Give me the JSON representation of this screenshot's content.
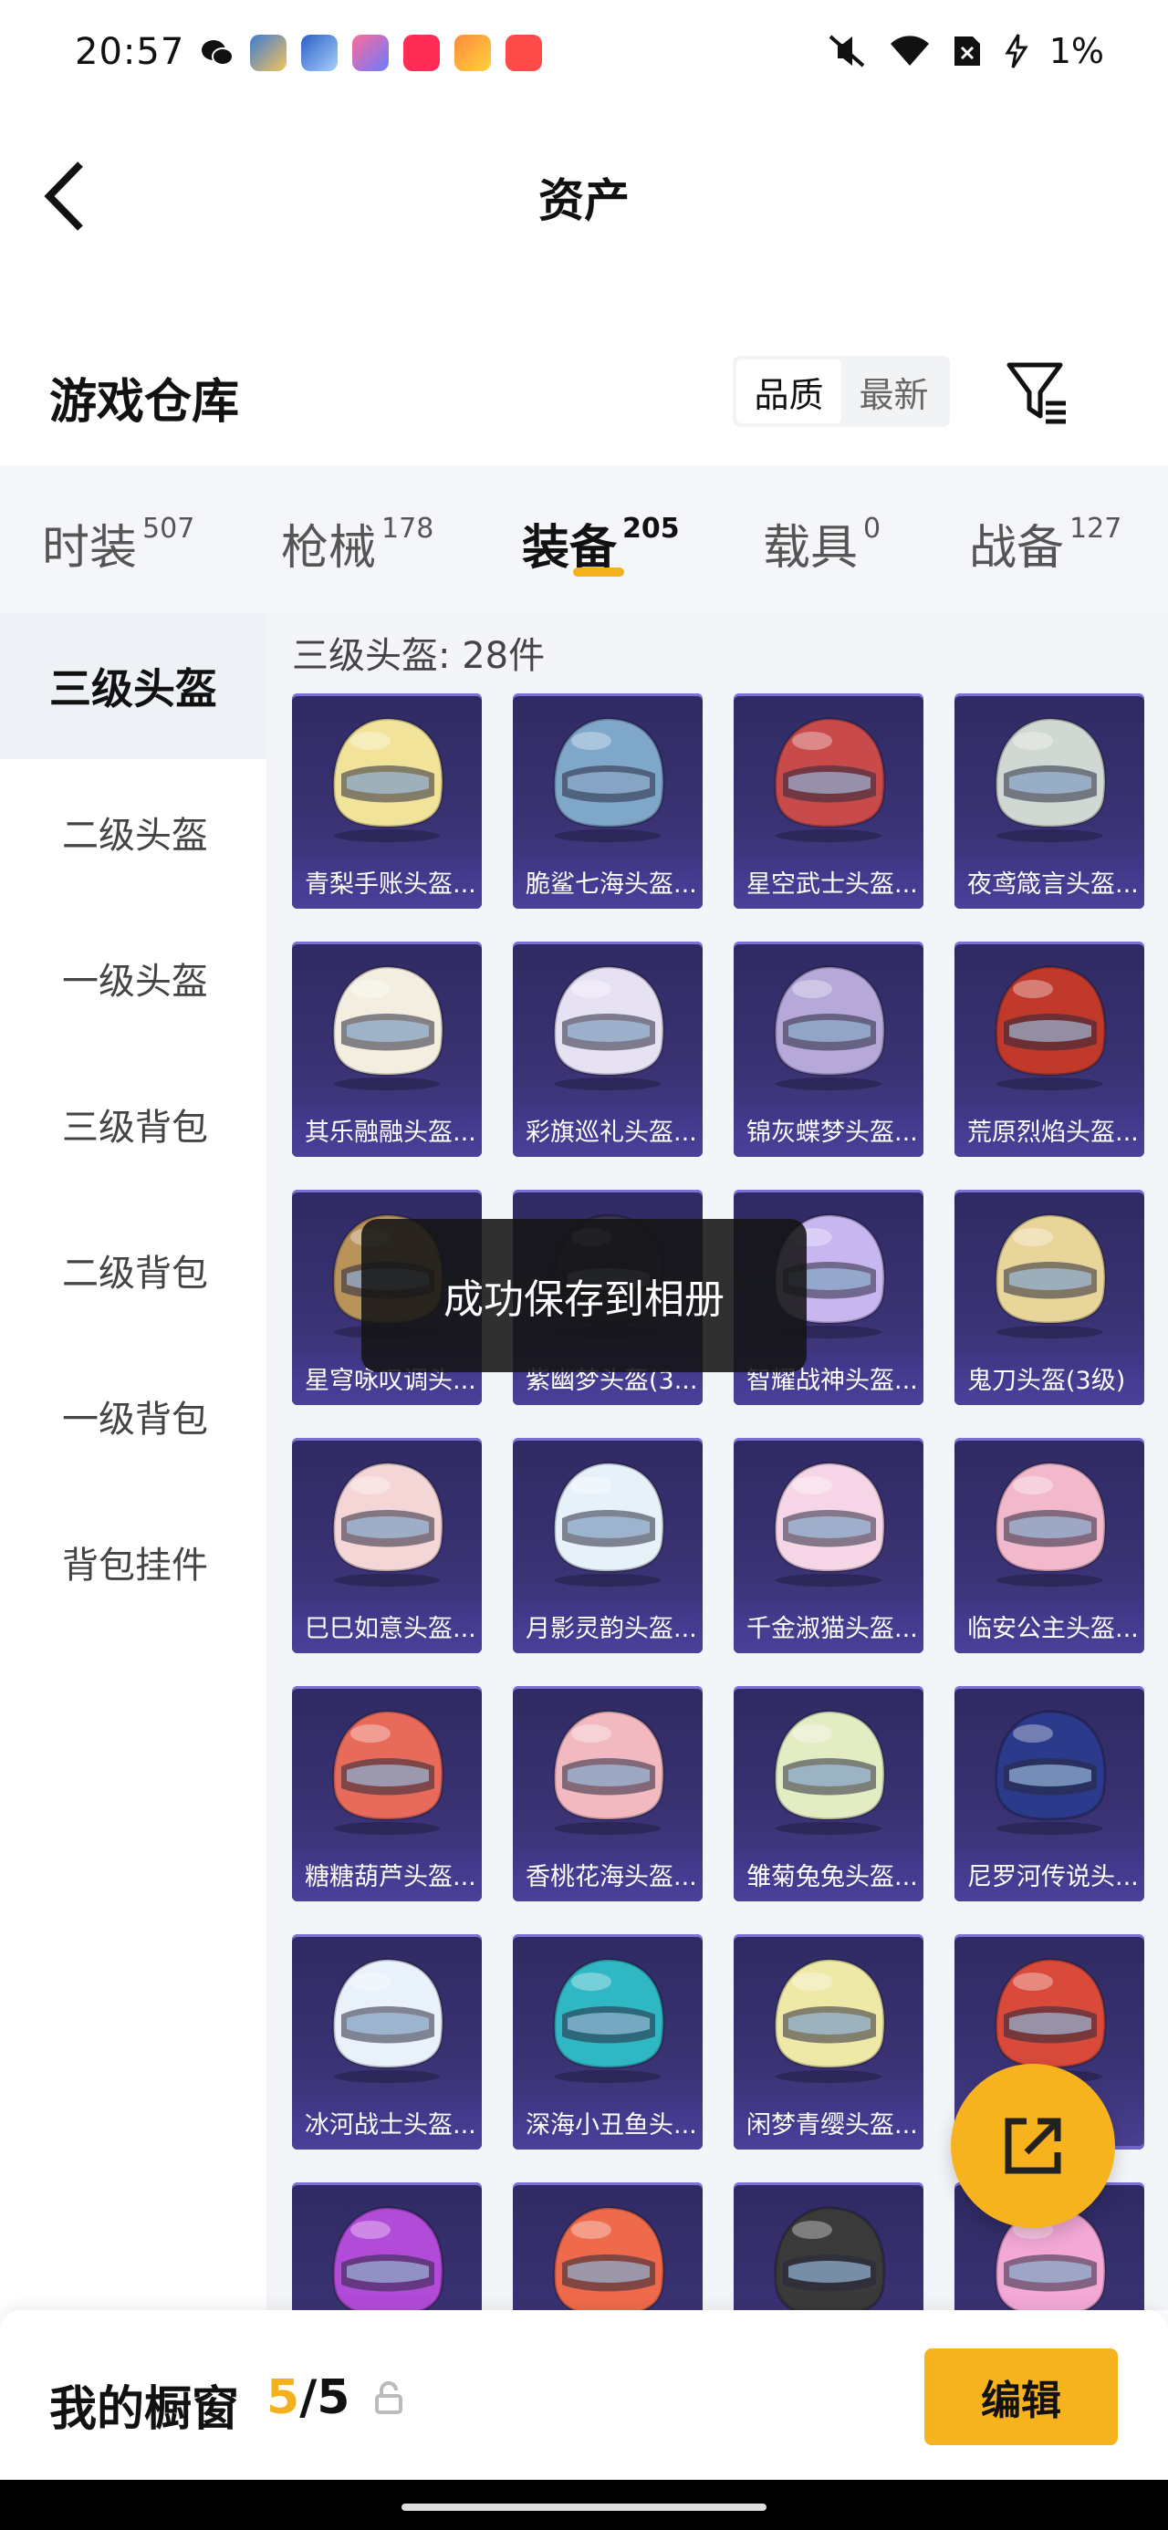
{
  "status_bar": {
    "time": "20:57",
    "battery": "1%",
    "notification_icons": [
      "wechat-icon",
      "game-app-icon",
      "game-app-icon-2",
      "star-app-icon",
      "music-app-icon",
      "flame-app-icon",
      "video-app-icon"
    ],
    "system_icons": [
      "mute-icon",
      "wifi-icon",
      "sim-off-icon",
      "charging-icon"
    ]
  },
  "header": {
    "title": "资产"
  },
  "warehouse": {
    "title": "游戏仓库",
    "sort_options": [
      "品质",
      "最新"
    ],
    "active_sort": "品质"
  },
  "tabs": [
    {
      "label": "时装",
      "count": "507"
    },
    {
      "label": "枪械",
      "count": "178"
    },
    {
      "label": "装备",
      "count": "205"
    },
    {
      "label": "载具",
      "count": "0"
    },
    {
      "label": "战备",
      "count": "127"
    }
  ],
  "active_tab": "装备",
  "sidenav": {
    "items": [
      "三级头盔",
      "二级头盔",
      "一级头盔",
      "三级背包",
      "二级背包",
      "一级背包",
      "背包挂件"
    ],
    "active": "三级头盔"
  },
  "content": {
    "count_label": "三级头盔: 28件",
    "items": [
      {
        "name": "青梨手账头盔...",
        "icon": "helmet-pear-icon",
        "color": "#f1e39a"
      },
      {
        "name": "脆鲨七海头盔...",
        "icon": "helmet-shark-icon",
        "color": "#7fa7c9"
      },
      {
        "name": "星空武士头盔...",
        "icon": "helmet-samurai-icon",
        "color": "#c94a4a"
      },
      {
        "name": "夜鸢箴言头盔...",
        "icon": "helmet-kite-icon",
        "color": "#cfd8d2"
      },
      {
        "name": "其乐融融头盔...",
        "icon": "helmet-white-icon",
        "color": "#f3eedf"
      },
      {
        "name": "彩旗巡礼头盔...",
        "icon": "helmet-flag-icon",
        "color": "#e6e1f3"
      },
      {
        "name": "锦灰蝶梦头盔...",
        "icon": "helmet-butterfly-icon",
        "color": "#b6a8d8"
      },
      {
        "name": "荒原烈焰头盔...",
        "icon": "helmet-flame-icon",
        "color": "#c0392b"
      },
      {
        "name": "星穹咏叹调头...",
        "icon": "helmet-aria-icon",
        "color": "#b9935a"
      },
      {
        "name": "紫幽梦头盔(3...",
        "icon": "helmet-purple-icon",
        "color": "#3a3552"
      },
      {
        "name": "智耀战神头盔...",
        "icon": "helmet-wargod-icon",
        "color": "#c8b6f0"
      },
      {
        "name": "鬼刀头盔(3级)",
        "icon": "helmet-ghostblade-icon",
        "color": "#e8d59a"
      },
      {
        "name": "巳巳如意头盔...",
        "icon": "helmet-snake-icon",
        "color": "#f4d6d6"
      },
      {
        "name": "月影灵韵头盔...",
        "icon": "helmet-moon-icon",
        "color": "#e6f1fa"
      },
      {
        "name": "千金淑猫头盔...",
        "icon": "helmet-cat-icon",
        "color": "#f6d6e6"
      },
      {
        "name": "临安公主头盔...",
        "icon": "helmet-princess-icon",
        "color": "#f2b8cc"
      },
      {
        "name": "糖糖葫芦头盔...",
        "icon": "helmet-candy-icon",
        "color": "#e86a5a"
      },
      {
        "name": "香桃花海头盔...",
        "icon": "helmet-peach-icon",
        "color": "#f2b9c0"
      },
      {
        "name": "雏菊兔兔头盔...",
        "icon": "helmet-rabbit-icon",
        "color": "#e4ecc4"
      },
      {
        "name": "尼罗河传说头...",
        "icon": "helmet-nile-icon",
        "color": "#2b3a8a"
      },
      {
        "name": "冰河战士头盔...",
        "icon": "helmet-glacier-icon",
        "color": "#e9f1fb"
      },
      {
        "name": "深海小丑鱼头...",
        "icon": "helmet-clownfish-icon",
        "color": "#2fb7c4"
      },
      {
        "name": "闲梦青缨头盔...",
        "icon": "helmet-dream-icon",
        "color": "#efe9a8"
      },
      {
        "name": "",
        "icon": "helmet-red-icon",
        "color": "#d94a3a"
      },
      {
        "name": "",
        "icon": "helmet-neon-icon",
        "color": "#b24bd8"
      },
      {
        "name": "",
        "icon": "helmet-coral-icon",
        "color": "#ef6a4a"
      },
      {
        "name": "",
        "icon": "helmet-black-icon",
        "color": "#3a3a3a"
      },
      {
        "name": "",
        "icon": "helmet-pinkdonut-icon",
        "color": "#f3a8d6"
      }
    ]
  },
  "toast": {
    "text": "成功保存到相册"
  },
  "bottom_bar": {
    "label": "我的橱窗",
    "current": "5",
    "separator": "/",
    "total": "5",
    "edit_label": "编辑"
  },
  "colors": {
    "accent": "#f7b31d",
    "card_bg": "#3a3273",
    "panel_bg": "#f3f5f8"
  }
}
